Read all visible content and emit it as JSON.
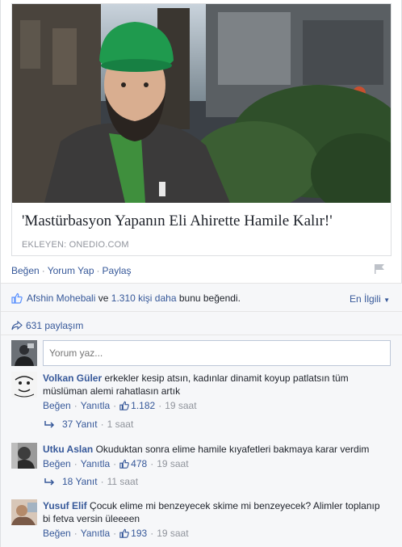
{
  "post": {
    "link_title": "'Mastürbasyon Yapanın Eli Ahirette Hamile Kalır!'",
    "link_source": "EKLEYEN: ONEDIO.COM"
  },
  "actions": {
    "like": "Beğen",
    "comment": "Yorum Yap",
    "share": "Paylaş"
  },
  "likes": {
    "person": "Afshin Mohebali",
    "connector": "ve",
    "others": "1.310 kişi daha",
    "suffix": "bunu beğendi."
  },
  "sort_label": "En İlgili",
  "shares_label": "631 paylaşım",
  "composer": {
    "placeholder": "Yorum yaz..."
  },
  "comments": [
    {
      "name": "Volkan Güler",
      "text": "erkekler kesip atsın, kadınlar dinamit koyup patlatsın tüm müslüman alemi rahatlasın artık",
      "like_label": "Beğen",
      "reply_label": "Yanıtla",
      "like_count": "1.182",
      "time": "19 saat",
      "replies": "37 Yanıt",
      "replies_time": "1 saat"
    },
    {
      "name": "Utku Aslan",
      "text": "Okuduktan sonra elime hamile kıyafetleri bakmaya karar verdim",
      "like_label": "Beğen",
      "reply_label": "Yanıtla",
      "like_count": "478",
      "time": "19 saat",
      "replies": "18 Yanıt",
      "replies_time": "11 saat"
    },
    {
      "name": "Yusuf Elif",
      "text": "Çocuk elime mi benzeyecek skime mi benzeyecek? Alimler toplanıp bi fetva versin üleeeen",
      "like_label": "Beğen",
      "reply_label": "Yanıtla",
      "like_count": "193",
      "time": "19 saat"
    }
  ],
  "colors": {
    "link_blue": "#365899",
    "meta_gray": "#90949c",
    "ufi_bg": "#f6f7f9"
  }
}
